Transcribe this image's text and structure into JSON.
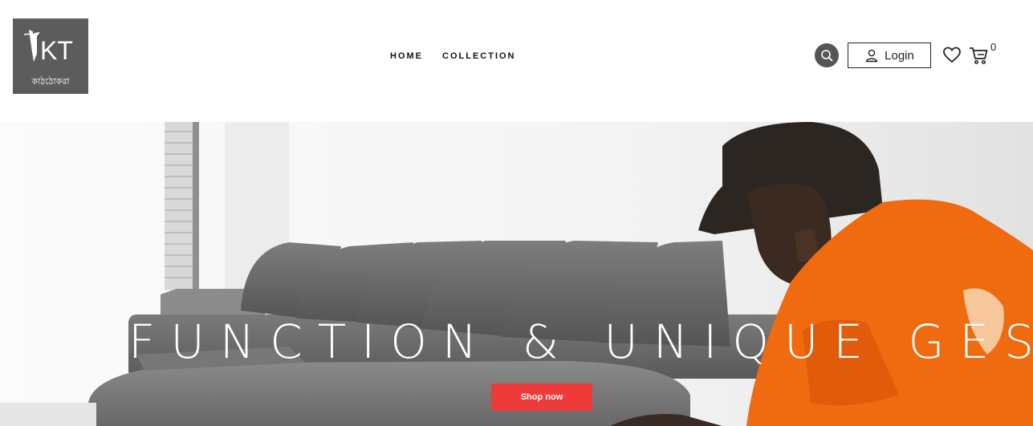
{
  "brand": {
    "logo_letters": "KT",
    "logo_tagline": "কাঠঠোকরা"
  },
  "nav": {
    "items": [
      {
        "label": "HOME"
      },
      {
        "label": "COLLECTION"
      }
    ]
  },
  "header_actions": {
    "search_icon": "search-icon",
    "login_label": "Login",
    "wishlist_icon": "heart-icon",
    "cart_icon": "cart-icon",
    "cart_count": "0"
  },
  "hero": {
    "title": "FUNCTION & UNIQUE GESTURE",
    "cta_label": "Shop now"
  },
  "colors": {
    "accent": "#ef3a3a",
    "logo_bg": "#5c5c5c",
    "shirt": "#f06a0f"
  }
}
